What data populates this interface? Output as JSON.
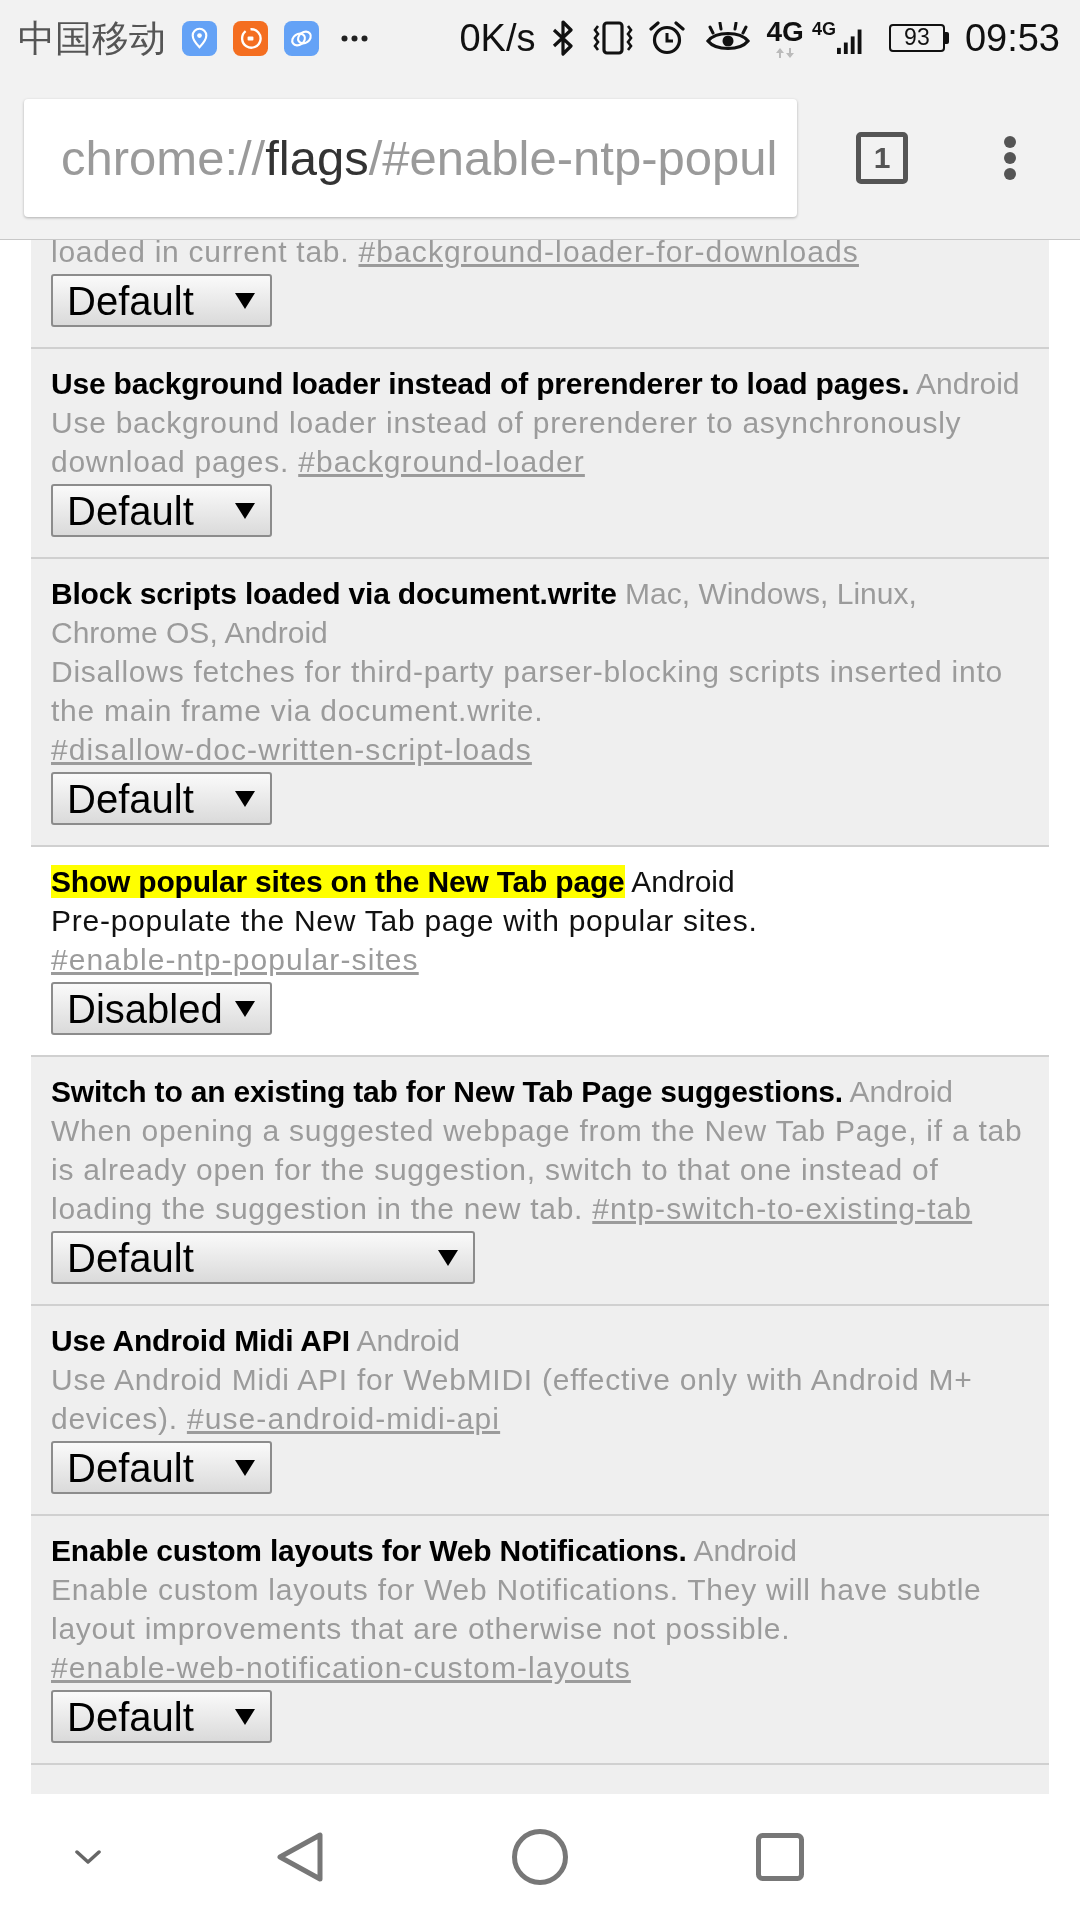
{
  "status_bar": {
    "carrier": "中国移动",
    "data_speed": "0K/s",
    "network_type": "4G",
    "signal_network": "4G",
    "battery": "93",
    "time": "09:53"
  },
  "toolbar": {
    "url": "chrome://**flags**/#enable-ntp-popul",
    "tab_count": "1"
  },
  "experiments": [
    {
      "description": "loaded in current tab.",
      "link": "#background-loader-for-downloads",
      "select": {
        "value": "Default",
        "kind": "narrow"
      },
      "highlighted": false
    },
    {
      "title": "Use background loader instead of prerenderer to load pages.",
      "platforms": "Android",
      "description": "Use background loader instead of prerenderer to asynchronously download pages.",
      "link": "#background-loader",
      "select": {
        "value": "Default",
        "kind": "narrow"
      },
      "highlighted": false
    },
    {
      "title": "Block scripts loaded via document.write",
      "platforms": "Mac, Windows, Linux, Chrome OS, Android",
      "description": "Disallows fetches for third-party parser-blocking scripts inserted into the main frame via document.write.",
      "link": "#disallow-doc-written-script-loads",
      "select": {
        "value": "Default",
        "kind": "narrow"
      },
      "highlighted": false
    },
    {
      "title": "Show popular sites on the New Tab page",
      "platforms": "Android",
      "description": "Pre-populate the New Tab page with popular sites.",
      "link": "#enable-ntp-popular-sites",
      "select": {
        "value": "Disabled",
        "kind": "narrow"
      },
      "highlighted": true
    },
    {
      "title": "Switch to an existing tab for New Tab Page suggestions.",
      "platforms": "Android",
      "description": "When opening a suggested webpage from the New Tab Page, if a tab is already open for the suggestion, switch to that one instead of loading the suggestion in the new tab.",
      "link": "#ntp-switch-to-existing-tab",
      "select": {
        "value": "Default",
        "kind": "wide"
      },
      "highlighted": false
    },
    {
      "title": "Use Android Midi API",
      "platforms": "Android",
      "description": "Use Android Midi API for WebMIDI (effective only with Android M+ devices).",
      "link": "#use-android-midi-api",
      "select": {
        "value": "Default",
        "kind": "narrow"
      },
      "highlighted": false
    },
    {
      "title": "Enable custom layouts for Web Notifications.",
      "platforms": "Android",
      "description": "Enable custom layouts for Web Notifications. They will have subtle layout improvements that are otherwise not possible.",
      "link": "#enable-web-notification-custom-layouts",
      "select": {
        "value": "Default",
        "kind": "narrow"
      },
      "highlighted": false
    }
  ]
}
